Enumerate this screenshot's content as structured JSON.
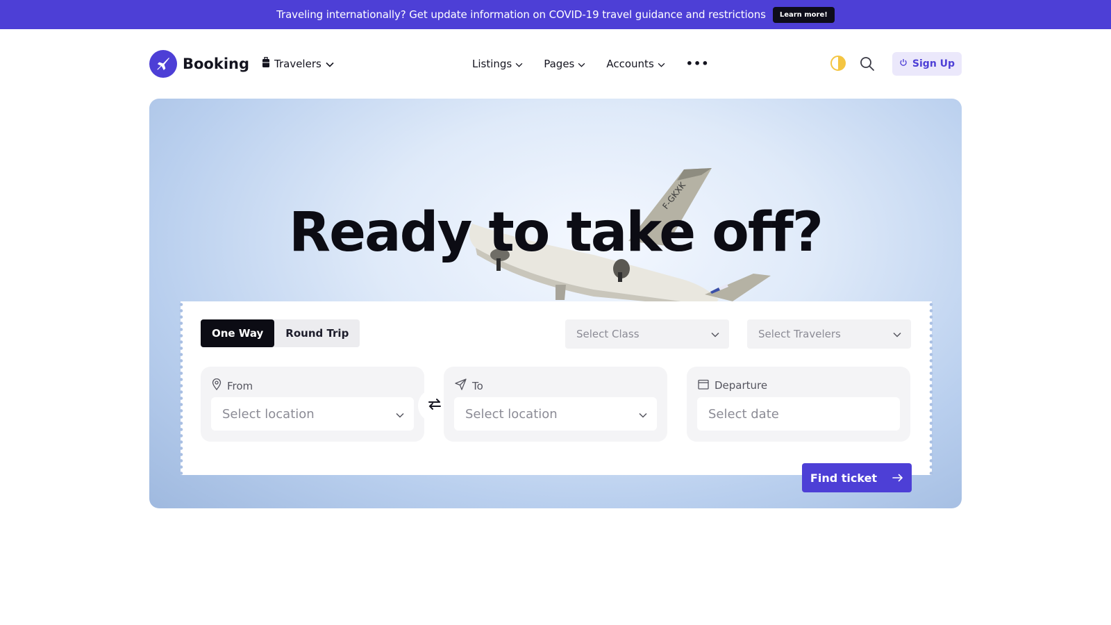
{
  "banner": {
    "text": "Traveling internationally? Get update information on COVID-19 travel guidance and restrictions",
    "cta": "Learn more!"
  },
  "header": {
    "brand": "Booking",
    "travelers_menu": "Travelers",
    "nav": [
      "Listings",
      "Pages",
      "Accounts"
    ],
    "more": "•••",
    "sign_up": "Sign Up"
  },
  "hero": {
    "title": "Ready to take off?",
    "plane_marking": "F-GKXK"
  },
  "search": {
    "trip_types": [
      "One Way",
      "Round Trip"
    ],
    "selected_trip": "One Way",
    "class_placeholder": "Select Class",
    "travelers_placeholder": "Select Travelers",
    "from_label": "From",
    "from_placeholder": "Select location",
    "to_label": "To",
    "to_placeholder": "Select location",
    "departure_label": "Departure",
    "departure_placeholder": "Select date",
    "submit": "Find ticket"
  },
  "colors": {
    "brand": "#4d3fd6",
    "dark": "#0c0c14",
    "accent_yellow": "#f4c542"
  },
  "icons": {
    "logo": "plane-icon",
    "travelers": "suitcase-icon",
    "theme": "half-sun-icon",
    "search": "search-icon",
    "signup": "power-icon",
    "from": "map-pin-icon",
    "to": "send-icon",
    "departure": "calendar-icon",
    "swap": "swap-arrows-icon",
    "submit": "arrow-right-icon"
  }
}
